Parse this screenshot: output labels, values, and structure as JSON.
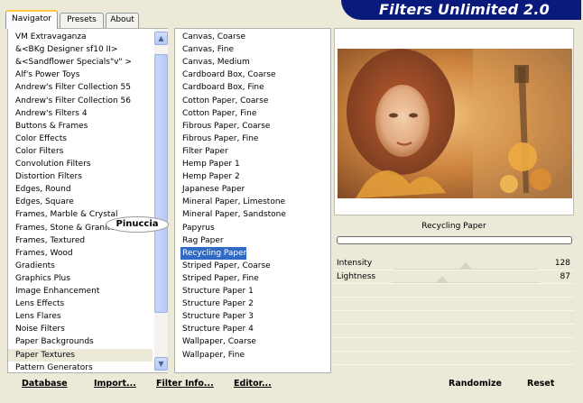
{
  "tabs": [
    {
      "label": "Navigator",
      "active": true
    },
    {
      "label": "Presets",
      "active": false
    },
    {
      "label": "About",
      "active": false
    }
  ],
  "app_title": "Filters Unlimited 2.0",
  "category_list": {
    "items": [
      "VM Extravaganza",
      "&<BKg Designer sf10 II>",
      "&<Sandflower Specials\"v\" >",
      "Alf's Power Toys",
      "Andrew's Filter Collection 55",
      "Andrew's Filter Collection 56",
      "Andrew's Filters 4",
      "Buttons & Frames",
      "Color Effects",
      "Color Filters",
      "Convolution Filters",
      "Distortion Filters",
      "Edges, Round",
      "Edges, Square",
      "Frames, Marble & Crystal",
      "Frames, Stone & Granite",
      "Frames, Textured",
      "Frames, Wood",
      "Gradients",
      "Graphics Plus",
      "Image Enhancement",
      "Lens Effects",
      "Lens Flares",
      "Noise Filters",
      "Paper Backgrounds",
      "Paper Textures",
      "Pattern Generators"
    ],
    "highlighted": "Paper Textures"
  },
  "watermark": "Pinuccia",
  "filter_list": {
    "items": [
      "Canvas, Coarse",
      "Canvas, Fine",
      "Canvas, Medium",
      "Cardboard Box, Coarse",
      "Cardboard Box, Fine",
      "Cotton Paper, Coarse",
      "Cotton Paper, Fine",
      "Fibrous Paper, Coarse",
      "Fibrous Paper, Fine",
      "Filter Paper",
      "Hemp Paper 1",
      "Hemp Paper 2",
      "Japanese Paper",
      "Mineral Paper, Limestone",
      "Mineral Paper, Sandstone",
      "Papyrus",
      "Rag Paper",
      "Recycling Paper",
      "Striped Paper, Coarse",
      "Striped Paper, Fine",
      "Structure Paper 1",
      "Structure Paper 2",
      "Structure Paper 3",
      "Structure Paper 4",
      "Wallpaper, Coarse",
      "Wallpaper, Fine"
    ],
    "selected": "Recycling Paper"
  },
  "preview": {
    "filter_name": "Recycling Paper",
    "progress": 0
  },
  "sliders": [
    {
      "label": "Intensity",
      "value": "128",
      "level": 0.5
    },
    {
      "label": "Lightness",
      "value": "87",
      "level": 0.34
    }
  ],
  "buttons": {
    "database": "Database",
    "import": "Import...",
    "filter_info": "Filter Info...",
    "editor": "Editor...",
    "randomize": "Randomize",
    "reset": "Reset"
  },
  "colors": {
    "selection": "#316ac5",
    "banner": "#0a1a7c"
  }
}
